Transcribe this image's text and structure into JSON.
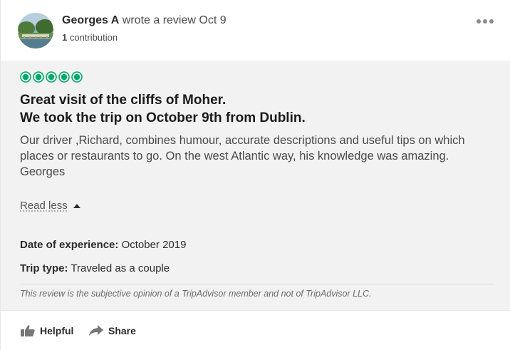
{
  "review": {
    "author": "Georges A",
    "action_text": "wrote a review Oct 9",
    "contribution_count": "1",
    "contribution_label": "contribution",
    "rating": 5,
    "rating_max": 5,
    "rating_color": "#00aa6c",
    "title_line1": "Great visit of the cliffs of Moher.",
    "title_line2": "We took the trip on October 9th from Dublin.",
    "body": "Our driver ,Richard, combines humour, accurate descriptions and useful tips on which places or restaurants to go. On the west Atlantic way, his knowledge was amazing.",
    "signature": "Georges",
    "read_less_label": "Read less",
    "date_label": "Date of experience:",
    "date_value": "October 2019",
    "trip_label": "Trip type:",
    "trip_value": "Traveled as a couple",
    "disclaimer": "This review is the subjective opinion of a TripAdvisor member and not of TripAdvisor LLC."
  },
  "actions": {
    "helpful_label": "Helpful",
    "share_label": "Share"
  },
  "icons": {
    "more": "more-options-icon",
    "caret": "caret-up-icon",
    "helpful": "thumbs-up-icon",
    "share": "share-arrow-icon"
  }
}
